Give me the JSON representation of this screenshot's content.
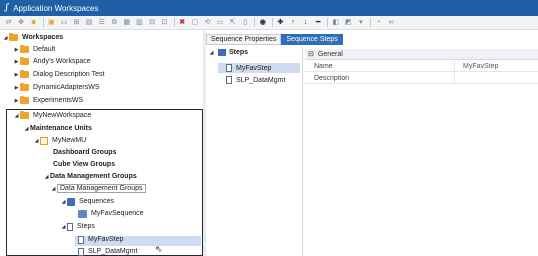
{
  "app": {
    "logo": "∫",
    "title": "Application Workspaces"
  },
  "toolbar": {
    "icons": [
      "swap-icon",
      "move-icon",
      "user-icon",
      "workspace-icon",
      "folder-icon",
      "folder-add-icon",
      "document-icon",
      "list-icon",
      "copy-icon",
      "grid-icon",
      "filter-icon",
      "sheet-icon",
      "sheet-copy-icon",
      "delete-icon",
      "save-icon",
      "undo-icon",
      "save-as-icon",
      "export-icon",
      "clipboard-icon",
      "view-icon",
      "add-icon",
      "arrow-up-icon",
      "arrow-down-icon",
      "minus-icon",
      "format-icon",
      "cube-icon",
      "chevron-down-icon",
      "ruler-icon",
      "link-icon"
    ]
  },
  "tree": {
    "workspaces": "Workspaces",
    "default": "Default",
    "andys": "Andy's Workspace",
    "dialog": "Dialog Description Test",
    "dynamic": "DynamicAdaptersWS",
    "experiments": "ExperimentsWS",
    "mynew": "MyNewWorkspace",
    "maintenance": "Maintenance Units",
    "mu": "MyNewMU",
    "dashboard": "Dashboard Groups",
    "cubeview": "Cube View Groups",
    "dmg": "Data Management Groups",
    "dmg_edit": "Data Management Groups",
    "sequences": "Sequences",
    "favseq": "MyFavSequence",
    "steps": "Steps",
    "favstep": "MyFavStep",
    "slp": "SLP_DataMgmt"
  },
  "tabs": {
    "seqprops": "Sequence Properties",
    "seqsteps": "Sequence Steps"
  },
  "steps_list": {
    "header": "Steps",
    "items": [
      "MyFavStep",
      "SLP_DataMgmt"
    ]
  },
  "properties": {
    "group": "General",
    "rows": [
      {
        "name": "Name",
        "value": "MyFavStep"
      },
      {
        "name": "Description",
        "value": ""
      }
    ]
  }
}
